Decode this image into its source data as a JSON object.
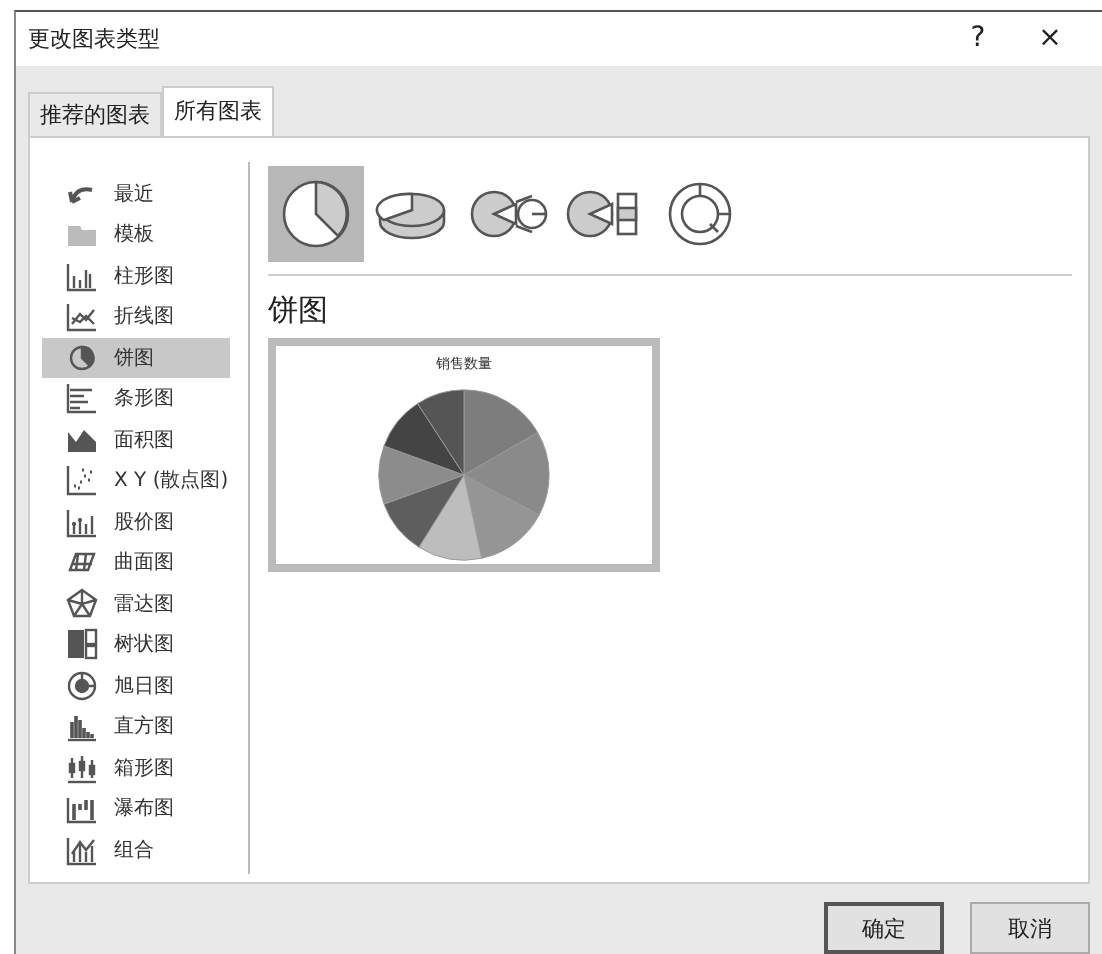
{
  "window": {
    "title": "更改图表类型",
    "help": "?",
    "close": "×"
  },
  "tabs": [
    {
      "label": "推荐的图表",
      "selected": false
    },
    {
      "label": "所有图表",
      "selected": true
    }
  ],
  "sidebar": {
    "items": [
      {
        "label": "最近",
        "kind": "recent",
        "selected": false
      },
      {
        "label": "模板",
        "kind": "template",
        "selected": false
      },
      {
        "label": "柱形图",
        "kind": "column",
        "selected": false
      },
      {
        "label": "折线图",
        "kind": "line",
        "selected": false
      },
      {
        "label": "饼图",
        "kind": "pie",
        "selected": true
      },
      {
        "label": "条形图",
        "kind": "bar",
        "selected": false
      },
      {
        "label": "面积图",
        "kind": "area",
        "selected": false
      },
      {
        "label": "X Y (散点图)",
        "kind": "scatter",
        "selected": false
      },
      {
        "label": "股价图",
        "kind": "stock",
        "selected": false
      },
      {
        "label": "曲面图",
        "kind": "surface",
        "selected": false
      },
      {
        "label": "雷达图",
        "kind": "radar",
        "selected": false
      },
      {
        "label": "树状图",
        "kind": "treemap",
        "selected": false
      },
      {
        "label": "旭日图",
        "kind": "sunburst",
        "selected": false
      },
      {
        "label": "直方图",
        "kind": "histogram",
        "selected": false
      },
      {
        "label": "箱形图",
        "kind": "box",
        "selected": false
      },
      {
        "label": "瀑布图",
        "kind": "waterfall",
        "selected": false
      },
      {
        "label": "组合",
        "kind": "combo",
        "selected": false
      }
    ]
  },
  "subtypes": [
    {
      "kind": "pie",
      "selected": true
    },
    {
      "kind": "pie3d",
      "selected": false
    },
    {
      "kind": "pieofpie",
      "selected": false
    },
    {
      "kind": "barofpie",
      "selected": false
    },
    {
      "kind": "doughnut",
      "selected": false
    }
  ],
  "preview": {
    "heading": "饼图",
    "chart_title": "销售数量"
  },
  "buttons": [
    {
      "label": "确定",
      "selected": true
    },
    {
      "label": "取消",
      "selected": false
    }
  ]
}
